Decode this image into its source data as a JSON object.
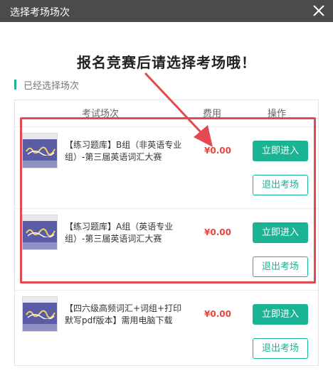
{
  "dialog": {
    "title": "选择考场场次"
  },
  "headline": "报名竞赛后请选择考场哦！",
  "section_label": "已经选择场次",
  "table": {
    "headers": [
      "考试场次",
      "费用",
      "操作"
    ]
  },
  "rows": [
    {
      "name": "【练习题库】B组（非英语专业组）-第三届英语词汇大赛",
      "price": "¥0.00",
      "enter": "立即进入",
      "exit": "退出考场"
    },
    {
      "name": "【练习题库】A组（英语专业组）-第三届英语词汇大赛",
      "price": "¥0.00",
      "enter": "立即进入",
      "exit": "退出考场"
    },
    {
      "name": "【四六级高频词汇+词组+打印默写pdf版本】需用电脑下载",
      "price": "¥0.00",
      "enter": "立即进入",
      "exit": "退出考场"
    }
  ],
  "icons": {
    "close": "close-icon",
    "cover": "book-cover-image",
    "arrow": "annotation-arrow"
  },
  "colors": {
    "accent": "#1ab394",
    "price": "#e8473f",
    "highlight": "#e24a4f",
    "titlebar": "#4b4b4b"
  }
}
